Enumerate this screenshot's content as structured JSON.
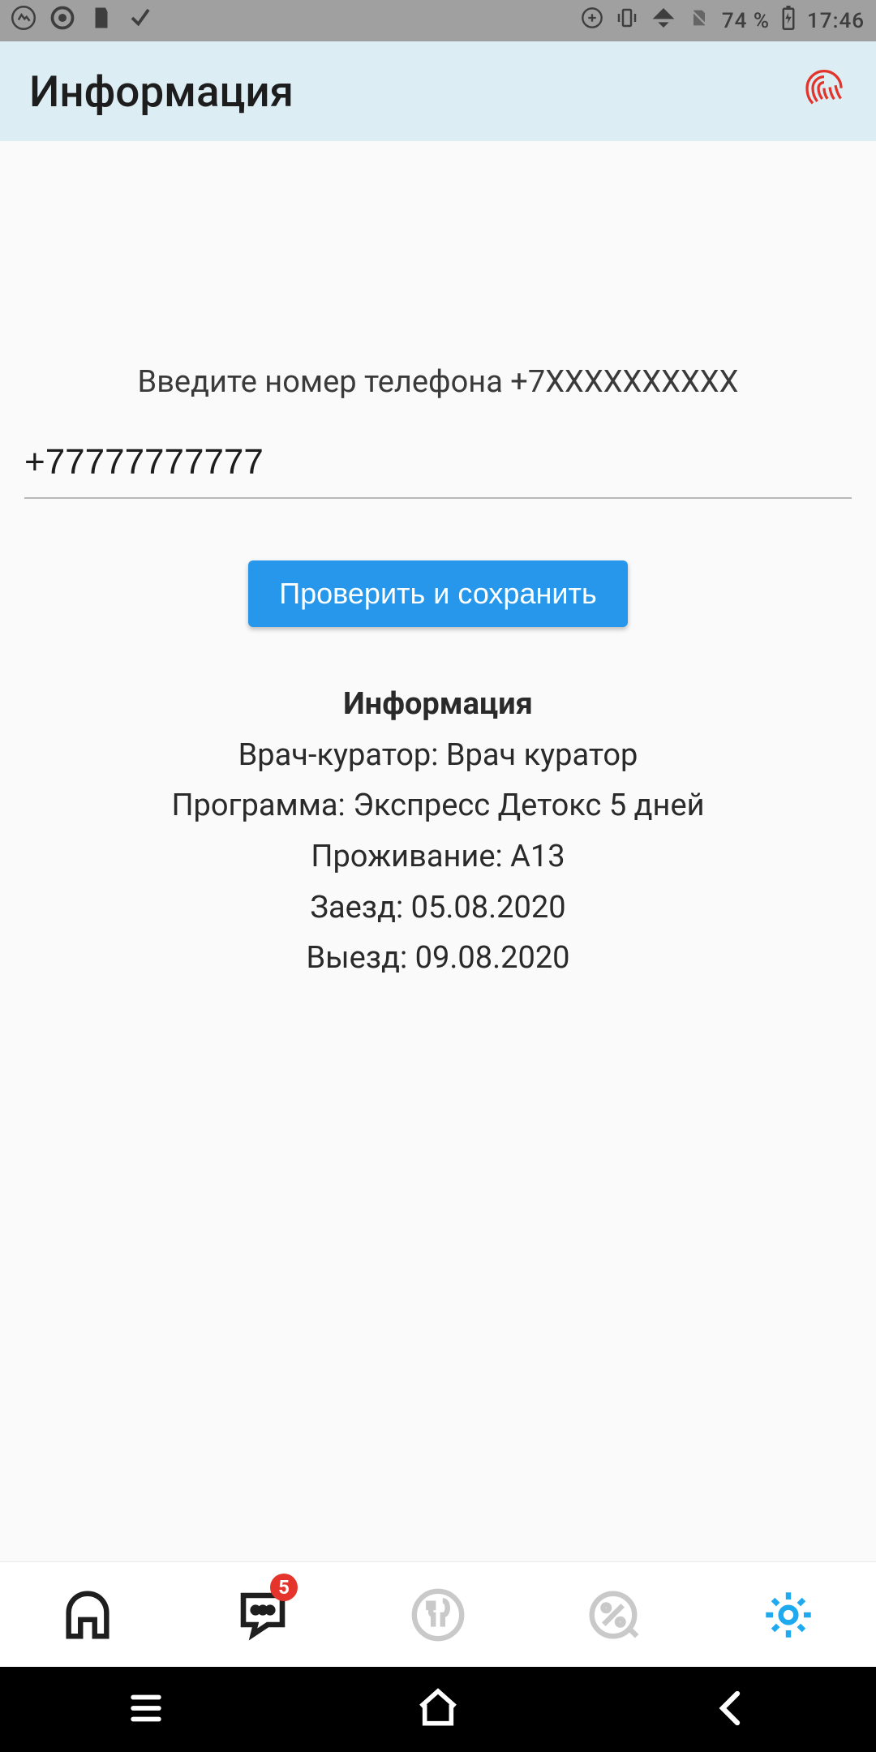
{
  "status": {
    "battery": "74 %",
    "time": "17:46"
  },
  "appbar": {
    "title": "Информация"
  },
  "form": {
    "prompt": "Введите номер телефона +7XXXXXXXXXX",
    "phone_value": "+77777777777",
    "submit_label": "Проверить и сохранить"
  },
  "info": {
    "heading": "Информация",
    "doctor": "Врач-куратор: Врач куратор",
    "program": "Программа: Экспресс Детокс 5 дней",
    "accommodation": "Проживание: A13",
    "checkin": "Заезд: 05.08.2020",
    "checkout": "Выезд: 09.08.2020"
  },
  "tabs": {
    "chat_badge": "5"
  }
}
